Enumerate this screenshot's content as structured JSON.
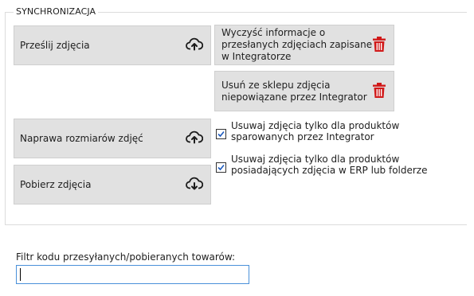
{
  "group": {
    "title": "SYNCHRONIZACJA"
  },
  "buttons": {
    "send_photos": "Prześlij zdjęcia",
    "clear_info": "Wyczyść informacje o przesłanych zdjęciach zapisane w Integratorze",
    "remove_unlinked": "Usuń ze sklepu zdjęcia niepowiązane przez Integrator",
    "repair_sizes": "Naprawa rozmiarów zdjęć",
    "download_photos": "Pobierz zdjęcia"
  },
  "checkboxes": [
    {
      "label": "Usuwaj zdjęcia tylko dla produktów sparowanych przez Integrator",
      "checked": true
    },
    {
      "label": "Usuwaj zdjęcia tylko dla produktów posiadających zdjęcia w ERP lub folderze",
      "checked": true
    }
  ],
  "filter": {
    "label": "Filtr kodu przesyłanych/pobieranych towarów:",
    "value": ""
  },
  "colors": {
    "trash": "#d11a1a",
    "check": "#1e5bbf",
    "input_border": "#4a90d9"
  },
  "icons": {
    "send": "cloud-upload-icon",
    "clear": "trash-icon",
    "remove": "trash-icon",
    "repair": "cloud-upload-icon",
    "download": "cloud-download-icon"
  }
}
